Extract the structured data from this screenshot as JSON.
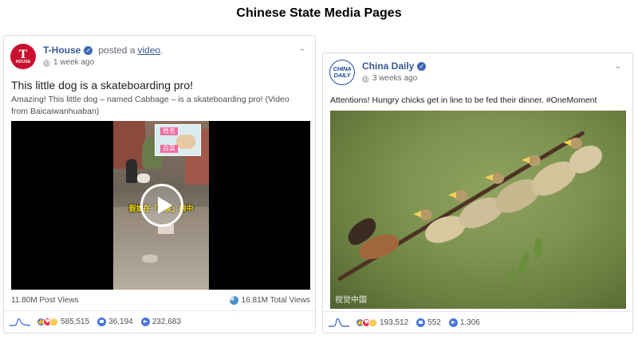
{
  "heading": "Chinese State Media Pages",
  "posts": [
    {
      "page_name": "T-House",
      "avatar_letter": "T",
      "avatar_sub": "HOUSE",
      "action_text": "posted a",
      "action_link": "video",
      "action_end": ".",
      "time": "1 week ago",
      "title": "This little dog is a skateboarding pro!",
      "text": "Amazing! This little dog – named Cabbage – is a skateboarding pro! (Video from Baicaiwanhuaban)",
      "video_overlay_top": "姓名",
      "video_overlay_bottom": "白菜",
      "video_banner": "假如在「板友」眼中",
      "post_views": "11.80M Post Views",
      "total_views": "16.81M Total Views",
      "reactions": "585,515",
      "comments": "36,194",
      "shares": "232,683"
    },
    {
      "page_name": "China Daily",
      "avatar_line1": "CHINA",
      "avatar_line2": "DAILY",
      "time": "3 weeks ago",
      "text": "Attentions! Hungry chicks get in line to be fed their dinner. #OneMoment",
      "watermark": "视觉中国",
      "reactions": "193,512",
      "comments": "552",
      "shares": "1,306"
    }
  ],
  "colors": {
    "link": "#385898",
    "t_house_red": "#c8102e",
    "china_daily_blue": "#1f4e9c",
    "reaction_like": "#4a76d9"
  },
  "icons": [
    "verified-icon",
    "globe-icon",
    "chevron-down-icon",
    "play-icon",
    "views-pie-icon",
    "sparkline-icon",
    "comment-icon",
    "share-icon"
  ]
}
